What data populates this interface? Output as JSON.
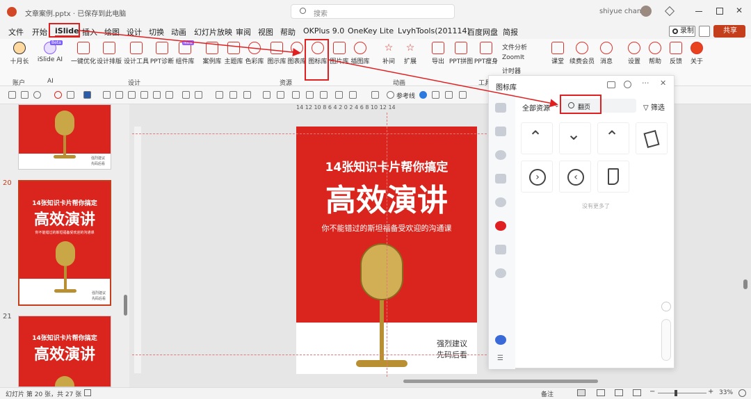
{
  "window": {
    "title": "文章案例.pptx · 已保存到此电脑",
    "search_placeholder": "搜索",
    "user": "shiyue chang"
  },
  "menu": [
    "文件",
    "开始",
    "iSlide",
    "插入",
    "绘图",
    "设计",
    "切换",
    "动画",
    "幻灯片放映",
    "审阅",
    "视图",
    "帮助",
    "OKPlus 9.0",
    "OneKey Lite",
    "LvyhTools(201114)",
    "百度网盘",
    "简报"
  ],
  "menu_right": {
    "record": "录制",
    "share": "共享"
  },
  "ribbon": {
    "buttons": [
      "十月长",
      "iSlide AI",
      "一键优化",
      "设计排版",
      "设计工具",
      "PPT诊断",
      "组件库",
      "案例库",
      "主题库",
      "色彩库",
      "图示库",
      "图表库",
      "图标库",
      "图片库",
      "插图库",
      "补间",
      "扩展",
      "导出",
      "PPT拼图",
      "PPT瘦身",
      "课堂",
      "续费会员",
      "消息",
      "设置",
      "帮助",
      "反馈",
      "关于"
    ],
    "small_buttons": [
      "文件分析",
      "ZoomIt",
      "计时器"
    ],
    "badges": {
      "ai": "Beta",
      "component": "New"
    },
    "groups": [
      "账户",
      "AI",
      "设计",
      "资源",
      "动画",
      "工具"
    ]
  },
  "quickbar": {
    "reference_line": "参考线"
  },
  "ruler": {
    "labels": [
      "14",
      "12",
      "10",
      "8",
      "6",
      "4",
      "2",
      "0",
      "2",
      "4",
      "6",
      "8",
      "10",
      "12",
      "14"
    ]
  },
  "slides": [
    {
      "number": "20",
      "headline": "14张知识卡片帮你搞定",
      "title": "高效演讲",
      "sub": "你不能错过的斯坦福备受欢迎的沟通课",
      "foot1": "强烈建议",
      "foot2": "先码后看"
    },
    {
      "number": "21",
      "headline": "14张知识卡片帮你搞定",
      "title": "高效演讲"
    }
  ],
  "main_slide": {
    "headline": "14张知识卡片帮你搞定",
    "title": "高效演讲",
    "sub": "你不能错过的斯坦福备受欢迎的沟通课",
    "foot1": "强烈建议",
    "foot2": "先码后看"
  },
  "icon_panel": {
    "title": "图标库",
    "filter_label": "全部资源",
    "search_value": "翻页",
    "filter_button": "筛选",
    "empty": "没有更多了",
    "icons": [
      "chevron-up-icon",
      "chevron-down-icon",
      "chevron-up-thin-icon",
      "page-stack-icon",
      "chevron-right-circle-icon",
      "chevron-left-circle-icon",
      "page-curl-icon"
    ]
  },
  "status": {
    "slide_info": "幻灯片 第 20 张，共 27 张",
    "notes": "备注",
    "zoom": "33%"
  },
  "colors": {
    "accent": "#d9251d",
    "highlight": "#e02020",
    "ribbon_icon": "#d9332b"
  }
}
